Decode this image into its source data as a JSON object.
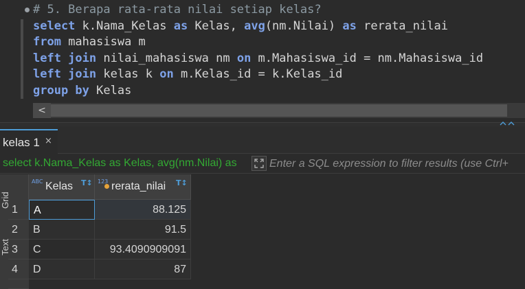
{
  "editor": {
    "lines": [
      {
        "parts": [
          {
            "t": "# 5. Berapa rata-rata nilai setiap kelas?",
            "c": "comment"
          }
        ]
      },
      {
        "parts": [
          {
            "t": "select",
            "c": "kw"
          },
          {
            "t": " k.Nama_Kelas ",
            "c": "txt"
          },
          {
            "t": "as",
            "c": "kw"
          },
          {
            "t": " Kelas, ",
            "c": "txt"
          },
          {
            "t": "avg",
            "c": "kw"
          },
          {
            "t": "(nm.Nilai) ",
            "c": "txt"
          },
          {
            "t": "as",
            "c": "kw"
          },
          {
            "t": " rerata_nilai",
            "c": "txt"
          }
        ]
      },
      {
        "parts": [
          {
            "t": "from",
            "c": "kw"
          },
          {
            "t": " mahasiswa m",
            "c": "txt"
          }
        ]
      },
      {
        "parts": [
          {
            "t": "left join",
            "c": "kw"
          },
          {
            "t": " nilai_mahasiswa nm ",
            "c": "txt"
          },
          {
            "t": "on",
            "c": "kw"
          },
          {
            "t": " m.Mahasiswa_id = nm.Mahasiswa_id",
            "c": "txt"
          }
        ]
      },
      {
        "parts": [
          {
            "t": "left join",
            "c": "kw"
          },
          {
            "t": " kelas k ",
            "c": "txt"
          },
          {
            "t": "on",
            "c": "kw"
          },
          {
            "t": " m.Kelas_id = k.Kelas_id",
            "c": "txt"
          }
        ]
      },
      {
        "parts": [
          {
            "t": "group by",
            "c": "kw"
          },
          {
            "t": " Kelas",
            "c": "txt"
          }
        ]
      }
    ],
    "scroll_left_glyph": "<"
  },
  "results": {
    "tab_label": "kelas 1",
    "tab_close": "×",
    "filter_query": "select k.Nama_Kelas as Kelas, avg(nm.Nilai) as",
    "filter_placeholder": "Enter a SQL expression to filter results (use Ctrl+",
    "side_tabs": [
      "Grid",
      "Text"
    ],
    "columns": [
      {
        "type_badge": "ABC",
        "name": "Kelas",
        "sort": "T↕"
      },
      {
        "type_badge": "123",
        "name": "rerata_nilai",
        "sort": "T↕"
      }
    ],
    "rows": [
      {
        "num": "1",
        "kelas": "A",
        "rerata": "88.125"
      },
      {
        "num": "2",
        "kelas": "B",
        "rerata": "91.5"
      },
      {
        "num": "3",
        "kelas": "C",
        "rerata": "93.4090909091"
      },
      {
        "num": "4",
        "kelas": "D",
        "rerata": "87"
      }
    ]
  },
  "colors": {
    "accent": "#4e9dd8",
    "keyword": "#7ea2e8",
    "filter_text": "#33a933",
    "selection": "#214b75"
  }
}
